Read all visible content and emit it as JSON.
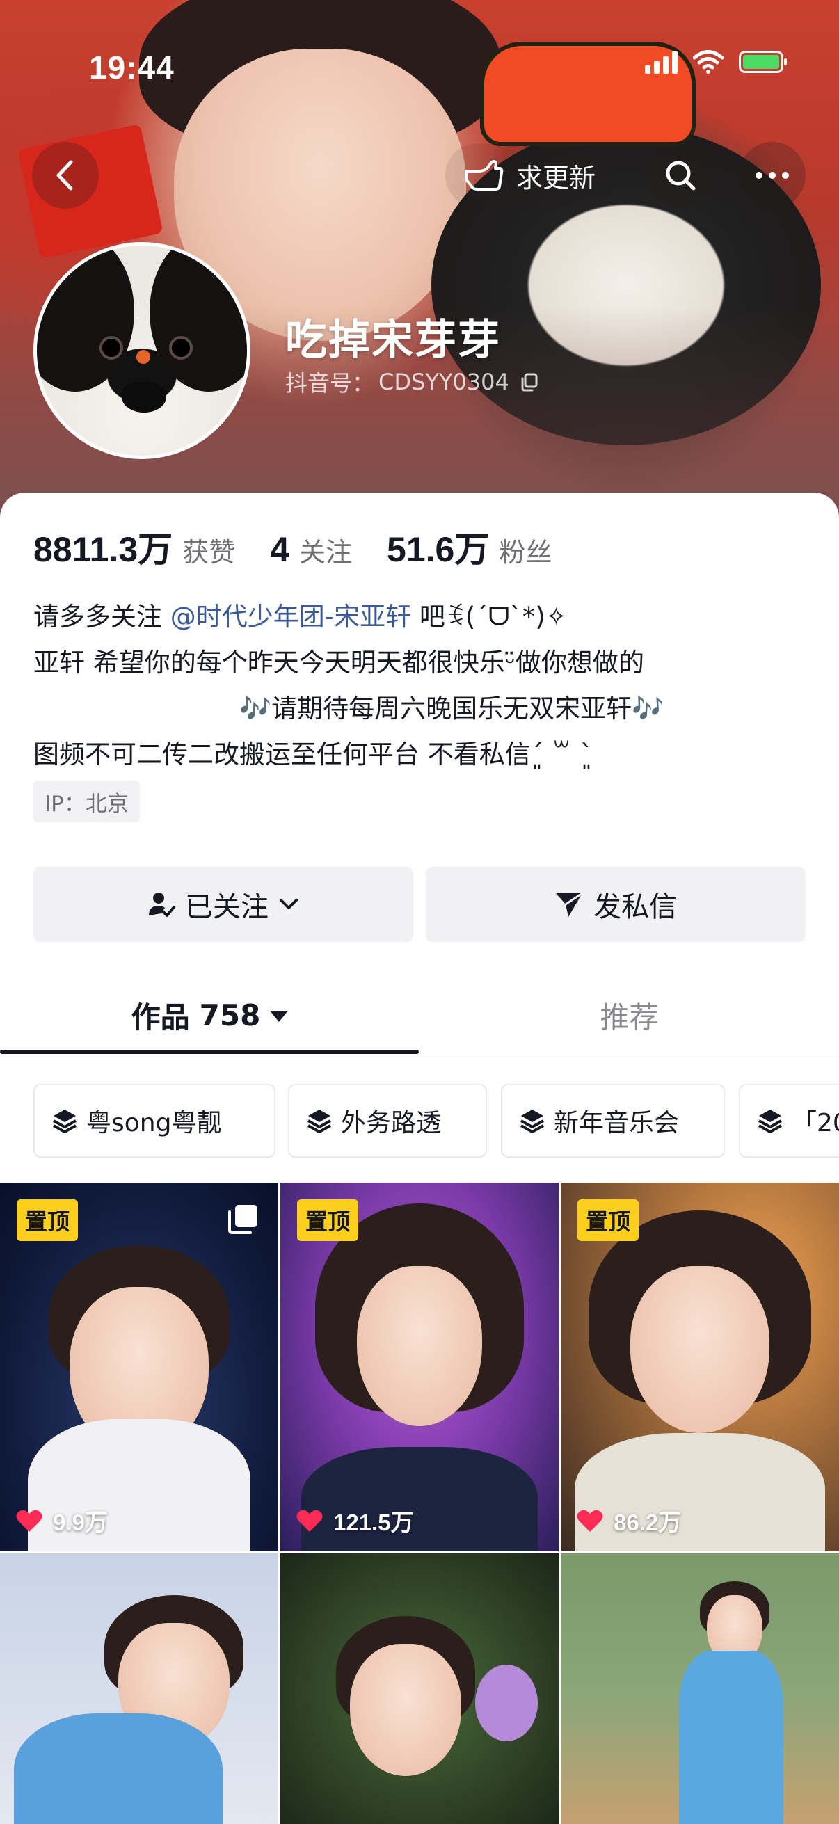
{
  "status_bar": {
    "time": "19:44"
  },
  "header": {
    "update_label": "求更新",
    "nickname": "吃掉宋芽芽",
    "douyin_id_label": "抖音号：",
    "douyin_id": "CDSYY0304"
  },
  "stats": {
    "likes_value": "8811.3万",
    "likes_label": "获赞",
    "following_value": "4",
    "following_label": "关注",
    "fans_value": "51.6万",
    "fans_label": "粉丝"
  },
  "bio": {
    "line1_prefix": "请多多关注 ",
    "mention": "@时代少年团-宋亚轩",
    "line1_suffix": " 吧ꉂ(ˊᗜˋ*)✧",
    "line2": "亚轩 希望你的每个昨天今天明天都很快乐ᵕ̈做你想做的",
    "line3": "🎶请期待每周六晚国乐无双宋亚轩🎶",
    "line4": "图频不可二传二改搬运至任何平台 不看私信ˊ͈ ꒳ ˋ͈",
    "ip": "IP：北京"
  },
  "actions": {
    "follow_label": "已关注",
    "message_label": "发私信"
  },
  "tabs": {
    "works_label": "作品",
    "works_count": "758",
    "recommend_label": "推荐"
  },
  "collections": [
    "粤song粤靓",
    "外务路透",
    "新年音乐会",
    "「20"
  ],
  "videos": [
    {
      "pinned": "置顶",
      "likes": "9.9万"
    },
    {
      "pinned": "置顶",
      "likes": "121.5万"
    },
    {
      "pinned": "置顶",
      "likes": "86.2万"
    }
  ],
  "colors": {
    "pin_badge": "#fccf1f",
    "like_heart": "#fe2c55",
    "mention": "#3a5a99"
  }
}
